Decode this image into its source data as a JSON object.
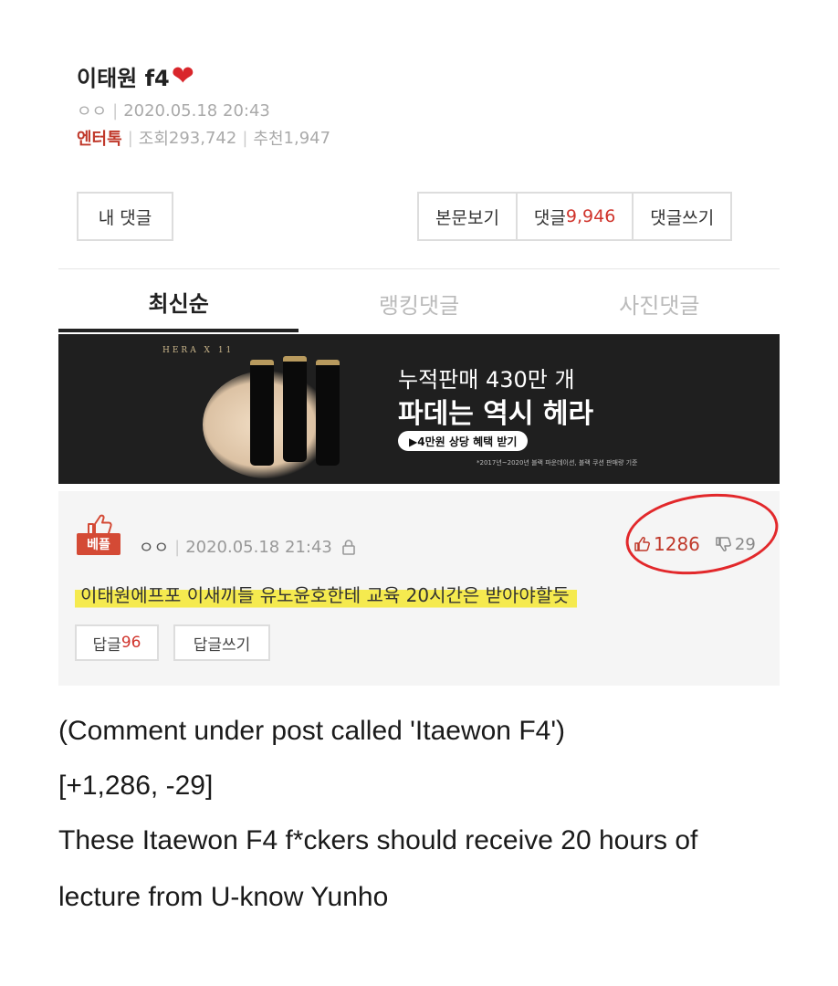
{
  "post": {
    "title": "이태원 f4",
    "author": "ㅇㅇ",
    "datetime": "2020.05.18 20:43",
    "category": "엔터톡",
    "views_label": "조회",
    "views": "293,742",
    "recommend_label": "추천",
    "recommend": "1,947"
  },
  "buttons": {
    "my_comment": "내 댓글",
    "view_post": "본문보기",
    "comments_label": "댓글",
    "comments_count": "9,946",
    "write_comment": "댓글쓰기"
  },
  "tabs": [
    {
      "label": "최신순",
      "active": true
    },
    {
      "label": "랭킹댓글",
      "active": false
    },
    {
      "label": "사진댓글",
      "active": false
    }
  ],
  "ad": {
    "brand": "HERA X 11",
    "line1": "누적판매 430만 개",
    "line2": "파데는 역시 헤라",
    "cta": "▶4만원 상당 혜택 받기",
    "fine_print": "*2017년~2020년 블랙 파운데이션, 블랙 쿠션 판매량 기준"
  },
  "comment": {
    "badge": "베플",
    "author": "ㅇㅇ",
    "datetime": "2020.05.18 21:43",
    "upvotes": "1286",
    "downvotes": "29",
    "text": "이태원에프포 이새끼들 유노윤호한테 교육 20시간은 받아야할듯",
    "reply_label": "답글",
    "reply_count": "96",
    "write_reply": "답글쓰기",
    "highlight_color": "#f5ea4f",
    "circle_color": "#e2282b"
  },
  "caption": {
    "line1": "(Comment under post called 'Itaewon F4')",
    "line2": "[+1,286, -29]",
    "line3": "These Itaewon F4 f*ckers should receive 20 hours of",
    "line4": "lecture from U-know Yunho"
  }
}
